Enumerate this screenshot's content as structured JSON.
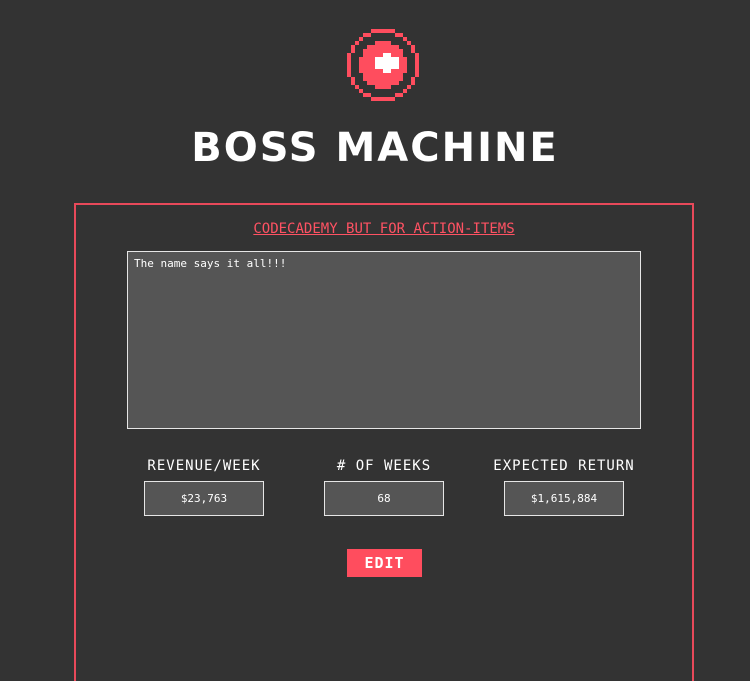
{
  "header": {
    "logo_icon": "red-pixel-button-icon",
    "title": "BOSS MACHINE"
  },
  "idea": {
    "name": "CODECADEMY BUT FOR ACTION-ITEMS",
    "description": "The name says it all!!!"
  },
  "metrics": [
    {
      "label": "REVENUE/WEEK",
      "value": "$23,763"
    },
    {
      "label": "# OF WEEKS",
      "value": "68"
    },
    {
      "label": "EXPECTED RETURN",
      "value": "$1,615,884"
    }
  ],
  "actions": {
    "edit_label": "EDIT"
  },
  "colors": {
    "background": "#333333",
    "accent": "#ff4d5e",
    "field_bg": "#555555",
    "text": "#ffffff"
  }
}
